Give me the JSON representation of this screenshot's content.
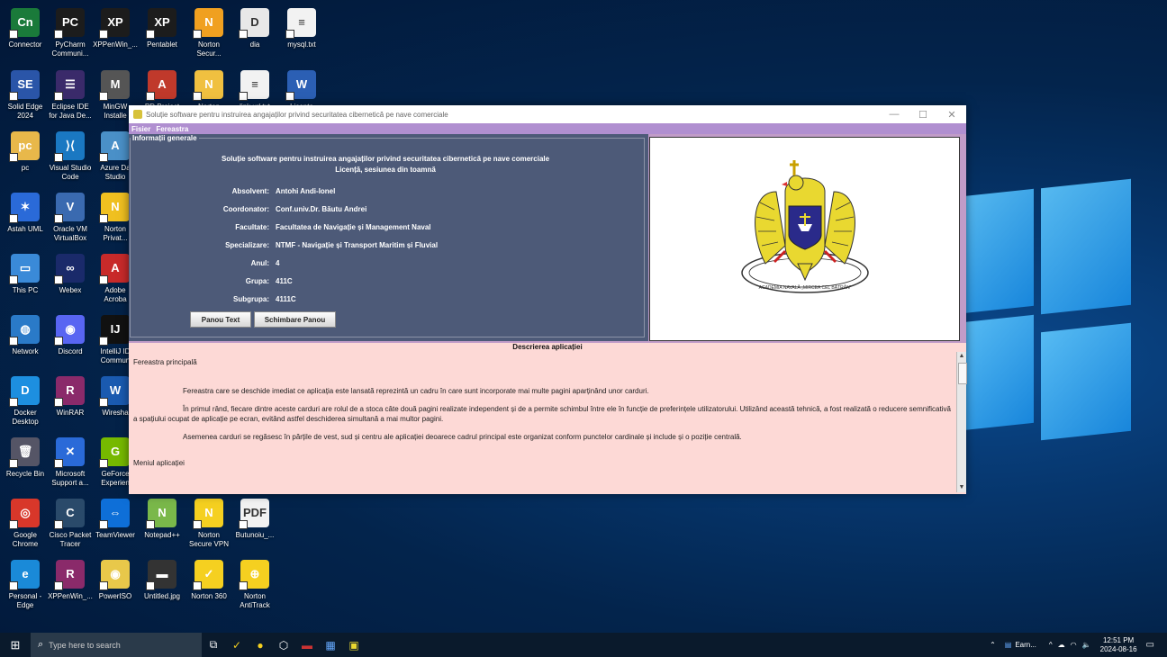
{
  "desktop": {
    "icons": [
      {
        "label": "Connector",
        "glyph": "Cn",
        "color": "#1a7a3a"
      },
      {
        "label": "PyCharm\nCommuni...",
        "glyph": "PC",
        "color": "#1c1c1c"
      },
      {
        "label": "XPPenWin_...",
        "glyph": "XP",
        "color": "#1c1c1c"
      },
      {
        "label": "Pentablet",
        "glyph": "XP",
        "color": "#1c1c1c"
      },
      {
        "label": "Norton\nSecur...",
        "glyph": "N",
        "color": "#f0a020"
      },
      {
        "label": "dia",
        "glyph": "D",
        "color": "#e8e8e8"
      },
      {
        "label": "mysql.txt",
        "glyph": "≡",
        "color": "#f2f2f2"
      },
      {
        "label": "Solid Edge\n2024",
        "glyph": "SE",
        "color": "#2a55a8"
      },
      {
        "label": "Eclipse IDE\nfor Java De...",
        "glyph": "☰",
        "color": "#3a2a6a"
      },
      {
        "label": "MinGW\nInstalle",
        "glyph": "M",
        "color": "#555"
      },
      {
        "label": "PD Project",
        "glyph": "A",
        "color": "#c0392b"
      },
      {
        "label": "Norton",
        "glyph": "N",
        "color": "#f0c040"
      },
      {
        "label": "link url.txt",
        "glyph": "≡",
        "color": "#f2f2f2"
      },
      {
        "label": "Licenta",
        "glyph": "W",
        "color": "#2b5fb4"
      },
      {
        "label": "pc",
        "glyph": "pc",
        "color": "#e8b84a"
      },
      {
        "label": "Visual Studio\nCode",
        "glyph": "⟩⟨",
        "color": "#1a78c2"
      },
      {
        "label": "Azure Da\nStudio",
        "glyph": "A",
        "color": "#4a90c8"
      },
      {
        "label": "Astah UML",
        "glyph": "✶",
        "color": "#2a6ad8"
      },
      {
        "label": "Oracle VM\nVirtualBox",
        "glyph": "V",
        "color": "#3a6ab0"
      },
      {
        "label": "Norton\nPrivat...",
        "glyph": "N",
        "color": "#f0c020"
      },
      {
        "label": "This PC",
        "glyph": "▭",
        "color": "#3a8ad8"
      },
      {
        "label": "Webex",
        "glyph": "∞",
        "color": "#1a2a6a"
      },
      {
        "label": "Adobe\nAcroba",
        "glyph": "A",
        "color": "#c82a2a"
      },
      {
        "label": "Network",
        "glyph": "◍",
        "color": "#2a7ac8"
      },
      {
        "label": "Discord",
        "glyph": "◉",
        "color": "#5865f2"
      },
      {
        "label": "IntelliJ ID\nCommun",
        "glyph": "IJ",
        "color": "#111"
      },
      {
        "label": "Docker\nDesktop",
        "glyph": "D",
        "color": "#1d8fe0"
      },
      {
        "label": "WinRAR",
        "glyph": "R",
        "color": "#8a2a6a"
      },
      {
        "label": "Wiresha",
        "glyph": "W",
        "color": "#1a5ab0"
      },
      {
        "label": "Recycle Bin",
        "glyph": "🗑",
        "color": "#556"
      },
      {
        "label": "Microsoft\nSupport a...",
        "glyph": "✕",
        "color": "#2a6ad8"
      },
      {
        "label": "GeForce\nExperien",
        "glyph": "G",
        "color": "#76b900"
      },
      {
        "label": "Google\nChrome",
        "glyph": "◎",
        "color": "#d8372a"
      },
      {
        "label": "Cisco Packet\nTracer",
        "glyph": "C",
        "color": "#2a4a6a"
      },
      {
        "label": "TeamViewer",
        "glyph": "⇔",
        "color": "#0e6fd8"
      },
      {
        "label": "Notepad++",
        "glyph": "N",
        "color": "#7ab84a"
      },
      {
        "label": "Norton\nSecure VPN",
        "glyph": "N",
        "color": "#f5d020"
      },
      {
        "label": "Butunoiu_...",
        "glyph": "PDF",
        "color": "#f2f2f2"
      },
      {
        "label": "Personal -\nEdge",
        "glyph": "e",
        "color": "#1a8ad8"
      },
      {
        "label": "XPPenWin_...",
        "glyph": "R",
        "color": "#8a2a6a"
      },
      {
        "label": "PowerISO",
        "glyph": "◉",
        "color": "#e8c84a"
      },
      {
        "label": "Untitled.jpg",
        "glyph": "▬",
        "color": "#333"
      },
      {
        "label": "Norton 360",
        "glyph": "✓",
        "color": "#f5d020"
      },
      {
        "label": "Norton\nAntiTrack",
        "glyph": "⊕",
        "color": "#f5d020"
      }
    ]
  },
  "window": {
    "title": "Soluție software pentru instruirea angajaților privind securitatea cibernetică pe nave comerciale",
    "minimize": "—",
    "maximize": "☐",
    "close": "✕",
    "menu": [
      "Fisier",
      "Fereastra"
    ],
    "info": {
      "legend": "Informații generale",
      "heading1": "Soluție software pentru instruirea angajaților privind securitatea cibernetică pe nave comerciale",
      "heading2": "Licență, sesiunea din toamnă",
      "rows": [
        {
          "k": "Absolvent:",
          "v": "Antohi Andi-Ionel"
        },
        {
          "k": "Coordonator:",
          "v": "Conf.univ.Dr. Băutu Andrei"
        },
        {
          "k": "Facultate:",
          "v": "Facultatea de Navigație și Management Naval"
        },
        {
          "k": "Specializare:",
          "v": "NTMF - Navigație și Transport Maritim și Fluvial"
        },
        {
          "k": "Anul:",
          "v": "4"
        },
        {
          "k": "Grupa:",
          "v": "411C"
        },
        {
          "k": "Subgrupa:",
          "v": "4111C"
        }
      ],
      "btn_panou_text": "Panou Text",
      "btn_schimbare": "Schimbare Panou"
    },
    "emblem_text": "ACADEMIA NAVALĂ „MIRCEA CEL BĂTRÂN”",
    "description": {
      "title": "Descrierea aplicației",
      "section1": "Fereastra principală",
      "p1": "Fereastra care se deschide imediat ce aplicația este lansată reprezintă un cadru în care sunt incorporate mai multe pagini aparținând unor carduri.",
      "p2": "În primul rând, fiecare dintre aceste carduri are rolul de a stoca câte două pagini realizate independent și de a permite schimbul între ele în funcție de preferințele utilizatorului. Utilizând această tehnică, a fost realizată o reducere semnificativă a spațiului ocupat de aplicație pe ecran, evitând astfel deschiderea simultană a mai multor pagini.",
      "p3": "Asemenea carduri se regăsesc în părțile de vest, sud și centru ale aplicației deoarece cadrul principal este organizat conform punctelor cardinale și include și o poziție centrală.",
      "section2": "Meniul aplicației"
    }
  },
  "taskbar": {
    "search_placeholder": "Type here to search",
    "running_app": "Earn...",
    "time": "12:51 PM",
    "date": "2024-08-16"
  }
}
